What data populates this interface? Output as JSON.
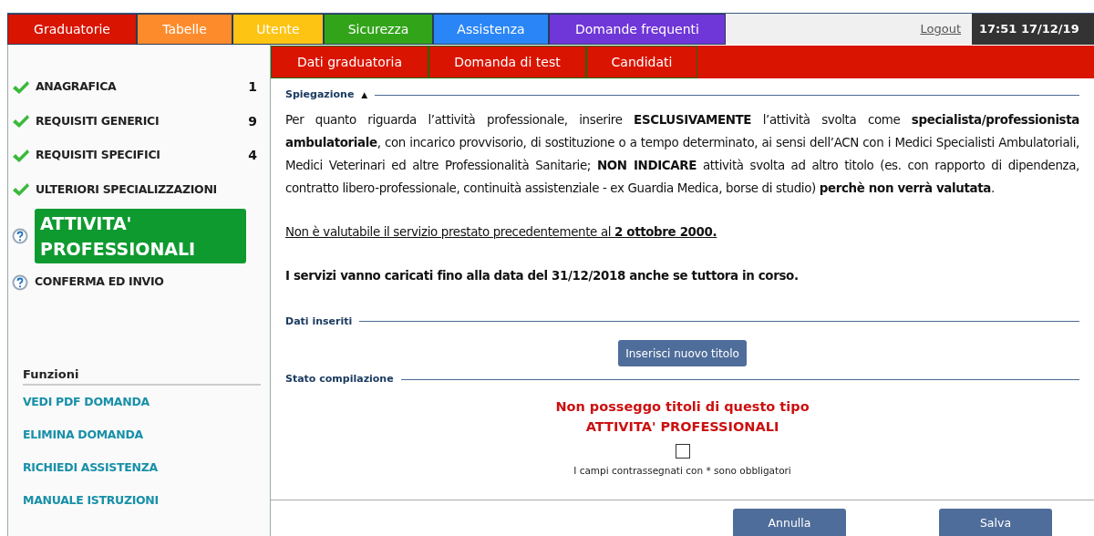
{
  "top_menu": [
    {
      "label": "Graduatorie",
      "color": "#d91400"
    },
    {
      "label": "Tabelle",
      "color": "#fd8b2c"
    },
    {
      "label": "Utente",
      "color": "#fdc414"
    },
    {
      "label": "Sicurezza",
      "color": "#32a41a"
    },
    {
      "label": "Assistenza",
      "color": "#2a86f6"
    },
    {
      "label": "Domande frequenti",
      "color": "#6f36d8"
    }
  ],
  "logout": "Logout",
  "clock": "17:51 17/12/19",
  "sub_tabs": [
    {
      "label": "Dati graduatoria"
    },
    {
      "label": "Domanda di test"
    },
    {
      "label": "Candidati"
    }
  ],
  "steps": [
    {
      "label": "ANAGRAFICA",
      "done": true,
      "count": "1",
      "selected": false
    },
    {
      "label": "REQUISITI GENERICI",
      "done": true,
      "count": "9",
      "selected": false
    },
    {
      "label": "REQUISITI SPECIFICI",
      "done": true,
      "count": "4",
      "selected": false
    },
    {
      "label": "ULTERIORI SPECIALIZZAZIONI",
      "done": true,
      "selected": false
    },
    {
      "label": "ATTIVITA' PROFESSIONALI",
      "done": false,
      "selected": true
    },
    {
      "label": "CONFERMA ED INVIO",
      "done": false,
      "selected": false
    }
  ],
  "functions": {
    "title": "Funzioni",
    "items": [
      "VEDI PDF DOMANDA",
      "ELIMINA DOMANDA",
      "RICHIEDI ASSISTENZA",
      "MANUALE ISTRUZIONI"
    ]
  },
  "explanation": {
    "legend": "Spiegazione",
    "toggle": "▲",
    "expanded": true,
    "paragraphs": [
      {
        "text": "Per quanto riguarda l’attività professionale, inserire **ESCLUSIVAMENTE** l’attività svolta come **specialista/professionista ambulatoriale**, con incarico provvisorio, di sostituzione o a tempo determinato, ai sensi dell’ACN con i Medici Specialisti Ambulatoriali, Medici Veterinari ed altre Professionalità Sanitarie; **NON INDICARE**  attività svolta ad altro titolo (es. con rapporto di dipendenza, contratto libero-professionale, continuità assistenziale - ex Guardia Medica, borse di studio) **perchè non verrà valutata**."
      },
      {
        "text": "Non è valutabile il servizio prestato precedentemente al **2 ottobre 2000.**",
        "underline": true
      },
      {
        "text": "I servizi vanno caricati fino alla data del 31/12/2018 anche se tuttora in corso.",
        "bold": true
      }
    ]
  },
  "inserted": {
    "legend": "Dati inseriti",
    "button": "Inserisci nuovo titolo"
  },
  "status": {
    "legend": "Stato compilazione",
    "line_1": "Non posseggo titoli di questo tipo",
    "line_2": "ATTIVITA' PROFESSIONALI",
    "checked": false,
    "note": "I campi contrassegnati con * sono obbligatori"
  },
  "buttons": [
    "Annulla",
    "Salva"
  ]
}
